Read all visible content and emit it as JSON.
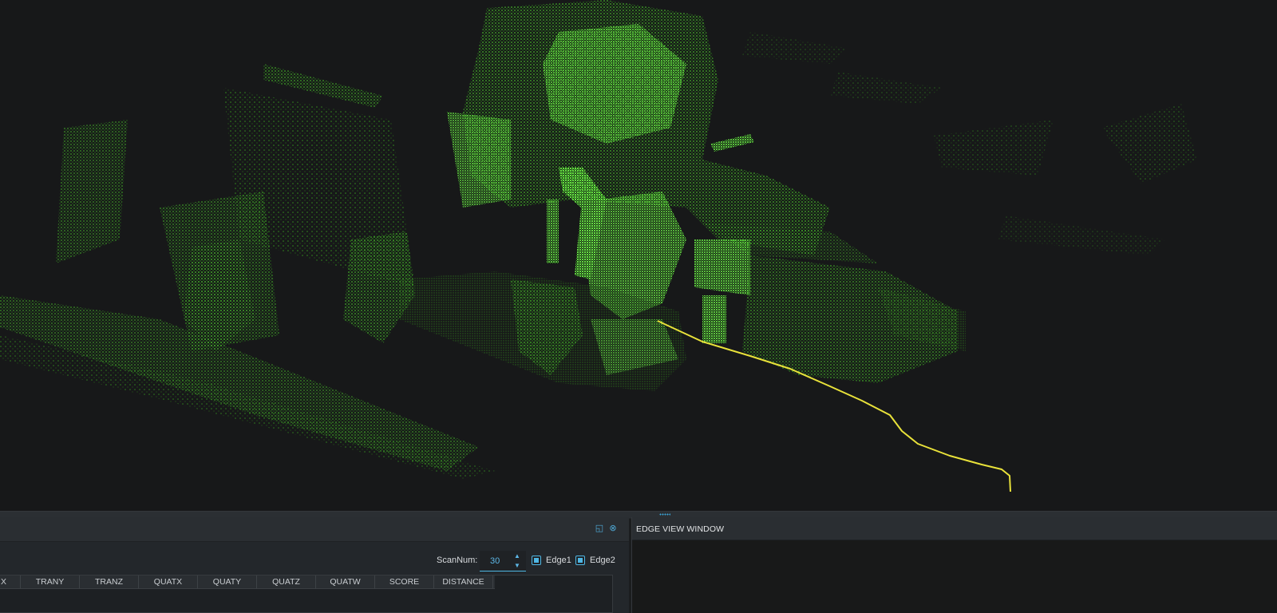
{
  "viewer": {
    "point_color": "#4ad12a",
    "trajectory_color": "#e9e23a",
    "background": "#171819"
  },
  "left_panel": {
    "float_icon": "float-icon",
    "close_icon": "close-icon",
    "scan_label": "ScanNum:",
    "scan_value": "30",
    "edge1_label": "Edge1",
    "edge2_label": "Edge2",
    "edge1_checked": true,
    "edge2_checked": true,
    "columns": [
      "X",
      "TRANY",
      "TRANZ",
      "QUATX",
      "QUATY",
      "QUATZ",
      "QUATW",
      "SCORE",
      "DISTANCE"
    ]
  },
  "right_panel": {
    "title": "EDGE VIEW WINDOW"
  },
  "accent": "#4fb7e4"
}
